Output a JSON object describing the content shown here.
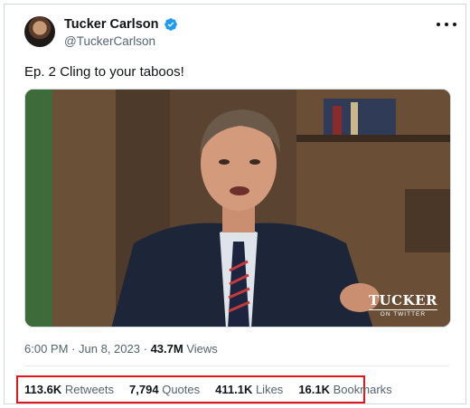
{
  "author": {
    "display_name": "Tucker Carlson",
    "handle": "@TuckerCarlson",
    "verified": true
  },
  "tweet": {
    "text": "Ep. 2  Cling to your taboos!"
  },
  "media": {
    "overlay_logo_line1": "TUCKER",
    "overlay_logo_line2": "ON TWITTER"
  },
  "meta": {
    "time": "6:00 PM",
    "separator": "·",
    "date": "Jun 8, 2023",
    "views_count": "43.7M",
    "views_label": "Views"
  },
  "stats": [
    {
      "count": "113.6K",
      "label": "Retweets"
    },
    {
      "count": "7,794",
      "label": "Quotes"
    },
    {
      "count": "411.1K",
      "label": "Likes"
    },
    {
      "count": "16.1K",
      "label": "Bookmarks"
    }
  ],
  "colors": {
    "verified_blue": "#1d9bf0",
    "highlight_box": "#e2141c",
    "secondary_text": "#536471"
  },
  "icons": {
    "verified": "verified-badge-icon",
    "more": "more-options-icon"
  }
}
